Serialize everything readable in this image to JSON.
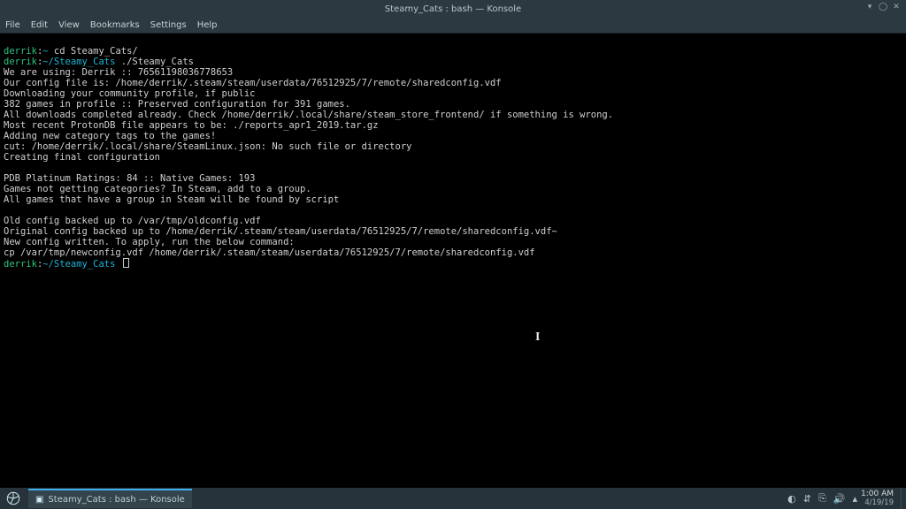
{
  "window": {
    "title": "Steamy_Cats : bash — Konsole"
  },
  "menubar": {
    "items": [
      "File",
      "Edit",
      "View",
      "Bookmarks",
      "Settings",
      "Help"
    ]
  },
  "prompt": {
    "user": "derrik",
    "host": "",
    "home_path": "~",
    "path2": "~/Steamy_Cats",
    "cmd1": "cd Steamy_Cats/",
    "cmd2": "./Steamy_Cats"
  },
  "terminal_lines": [
    "We are using: Derrik :: 76561198036778653",
    "Our config file is: /home/derrik/.steam/steam/userdata/76512925/7/remote/sharedconfig.vdf",
    "Downloading your community profile, if public",
    "382 games in profile :: Preserved configuration for 391 games.",
    "All downloads completed already. Check /home/derrik/.local/share/steam_store_frontend/ if something is wrong.",
    "Most recent ProtonDB file appears to be: ./reports_apr1_2019.tar.gz",
    "Adding new category tags to the games!",
    "cut: /home/derrik/.local/share/SteamLinux.json: No such file or directory",
    "Creating final configuration",
    "",
    "PDB Platinum Ratings: 84 :: Native Games: 193",
    "Games not getting categories? In Steam, add to a group.",
    "All games that have a group in Steam will be found by script",
    "",
    "Old config backed up to /var/tmp/oldconfig.vdf",
    "Original config backed up to /home/derrik/.steam/steam/userdata/76512925/7/remote/sharedconfig.vdf~",
    "New config written. To apply, run the below command:",
    "cp /var/tmp/newconfig.vdf /home/derrik/.steam/steam/userdata/76512925/7/remote/sharedconfig.vdf"
  ],
  "taskbar": {
    "task_label": "Steamy_Cats : bash — Konsole",
    "time": "1:00 AM",
    "date": "4/19/19"
  }
}
